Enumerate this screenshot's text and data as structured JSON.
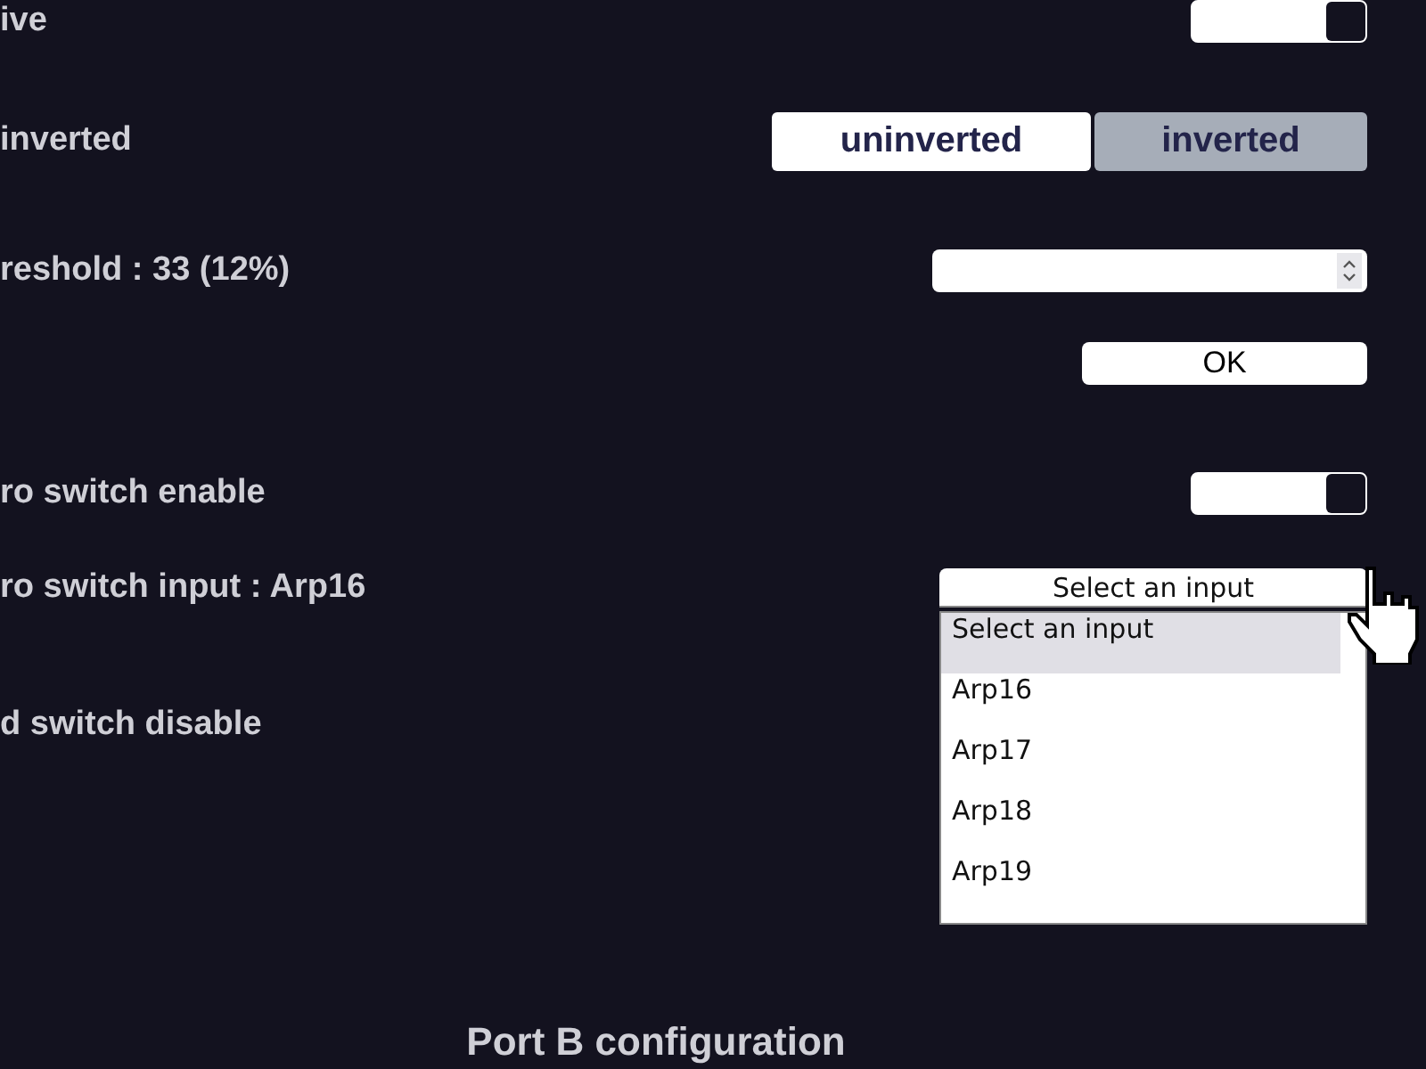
{
  "rows": [
    {
      "kind": "toggle",
      "label": "ive",
      "on": true
    },
    {
      "kind": "segmented",
      "label": "inverted",
      "options": [
        {
          "label": "uninverted",
          "selected": false
        },
        {
          "label": "inverted",
          "selected": true
        }
      ]
    },
    {
      "kind": "number",
      "label": "reshold : 33 (12%)"
    },
    {
      "kind": "button",
      "button": "OK"
    },
    {
      "kind": "toggle",
      "label": "ro switch enable",
      "on": true
    },
    {
      "kind": "select",
      "label": "ro switch input : Arp16",
      "value": "Select an input",
      "expanded": true,
      "options": [
        {
          "label": "Select an input",
          "selected": true
        },
        {
          "label": "Arp16",
          "selected": false
        },
        {
          "label": "Arp17",
          "selected": false
        },
        {
          "label": "Arp18",
          "selected": false
        },
        {
          "label": "Arp19",
          "selected": false
        }
      ]
    },
    {
      "kind": "label",
      "label": "d switch disable"
    }
  ],
  "section_heading": "Port B configuration"
}
